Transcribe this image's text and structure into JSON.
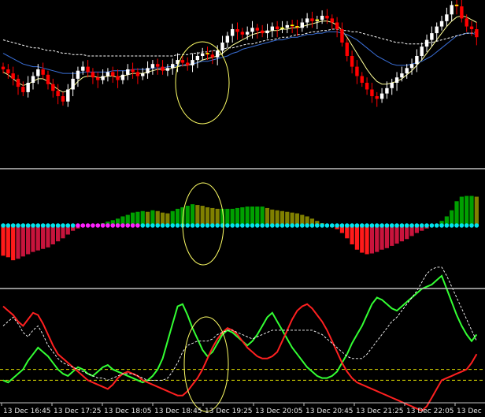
{
  "theme": {
    "background": "#000000",
    "separator": "#c0c0c0",
    "bull_candle": "#ffffff",
    "bear_candle": "#ff0000",
    "doji_mark": "#ffff00",
    "ma_fast": "#ffff99",
    "ma_mid": "#3a6fd8",
    "ma_slow": "#ffffff",
    "histo_up_bright": "#00a000",
    "histo_up_dim": "#808000",
    "histo_down_bright": "#ff1a1a",
    "histo_down_dim": "#c8143c",
    "dot_cyan": "#00e5ee",
    "dot_magenta": "#ff20ff",
    "stoch_green": "#33ff33",
    "stoch_red": "#ff2020",
    "stoch_level": "#e0e000",
    "highlight_ellipse": "#ffff66"
  },
  "chart_data": [
    {
      "type": "candlestick",
      "pane": "price",
      "title": "",
      "bar_count": 96,
      "ylim": [
        0,
        100
      ],
      "candles_close": [
        60,
        57,
        53,
        47,
        43,
        50,
        55,
        60,
        56,
        49,
        44,
        40,
        36,
        45,
        53,
        59,
        62,
        58,
        54,
        52,
        55,
        58,
        55,
        52,
        56,
        60,
        58,
        55,
        57,
        61,
        64,
        62,
        59,
        61,
        64,
        67,
        65,
        63,
        67,
        70,
        72,
        71,
        69,
        74,
        80,
        85,
        90,
        88,
        86,
        88,
        91,
        89,
        87,
        89,
        92,
        90,
        91,
        93,
        92,
        91,
        95,
        98,
        96,
        97,
        100,
        98,
        95,
        90,
        80,
        70,
        62,
        55,
        50,
        45,
        40,
        38,
        42,
        46,
        50,
        54,
        57,
        61,
        64,
        70,
        77,
        82,
        87,
        92,
        96,
        101,
        108,
        107,
        98,
        92,
        90,
        84
      ],
      "moving_averages": [
        {
          "id": "ma_fast",
          "style": "solid",
          "values": [
            58,
            56,
            53,
            50,
            48,
            49,
            51,
            53,
            53,
            51,
            48,
            45,
            43,
            44,
            47,
            51,
            54,
            55,
            55,
            54,
            54,
            55,
            55,
            54,
            55,
            56,
            57,
            57,
            57,
            58,
            59,
            60,
            60,
            60,
            61,
            62,
            63,
            63,
            64,
            65,
            67,
            68,
            69,
            70,
            72,
            75,
            78,
            80,
            82,
            84,
            86,
            87,
            88,
            88,
            89,
            89,
            90,
            90,
            91,
            91,
            92,
            93,
            94,
            95,
            96,
            96,
            95,
            93,
            89,
            84,
            78,
            72,
            66,
            60,
            55,
            51,
            49,
            49,
            50,
            51,
            53,
            56,
            59,
            63,
            67,
            72,
            77,
            82,
            87,
            92,
            96,
            99,
            100,
            99,
            97,
            95
          ]
        },
        {
          "id": "ma_mid",
          "style": "solid",
          "values": [
            72,
            70,
            68,
            66,
            64,
            63,
            62,
            62,
            61,
            60,
            59,
            58,
            57,
            57,
            57,
            57,
            58,
            58,
            58,
            58,
            58,
            58,
            59,
            59,
            59,
            59,
            60,
            60,
            60,
            60,
            61,
            61,
            61,
            62,
            62,
            63,
            63,
            64,
            64,
            65,
            66,
            66,
            67,
            68,
            69,
            70,
            72,
            73,
            75,
            76,
            77,
            78,
            79,
            80,
            81,
            82,
            82,
            83,
            84,
            84,
            85,
            86,
            86,
            87,
            87,
            88,
            88,
            88,
            87,
            86,
            84,
            82,
            79,
            76,
            73,
            70,
            68,
            66,
            64,
            63,
            63,
            63,
            64,
            65,
            66,
            68,
            70,
            73,
            76,
            79,
            82,
            85,
            86,
            87,
            87,
            86
          ]
        },
        {
          "id": "ma_slow",
          "style": "dashed",
          "values": [
            82,
            81,
            80,
            79,
            78,
            77,
            76,
            76,
            75,
            74,
            74,
            73,
            72,
            72,
            71,
            71,
            71,
            70,
            70,
            70,
            70,
            70,
            70,
            70,
            70,
            70,
            70,
            70,
            70,
            70,
            70,
            70,
            70,
            70,
            70,
            71,
            71,
            71,
            72,
            72,
            73,
            73,
            74,
            74,
            75,
            76,
            76,
            77,
            78,
            79,
            79,
            80,
            81,
            82,
            82,
            83,
            84,
            84,
            85,
            86,
            86,
            87,
            88,
            88,
            89,
            89,
            90,
            90,
            89,
            89,
            88,
            88,
            87,
            86,
            85,
            84,
            83,
            82,
            81,
            80,
            80,
            79,
            79,
            79,
            79,
            80,
            80,
            81,
            82,
            83,
            84,
            85,
            86,
            87,
            87,
            88
          ]
        }
      ]
    },
    {
      "type": "bar",
      "pane": "histogram",
      "title": "",
      "ylim": [
        -50,
        50
      ],
      "values": [
        -40,
        -42,
        -46,
        -44,
        -41,
        -38,
        -35,
        -33,
        -31,
        -29,
        -25,
        -21,
        -17,
        -12,
        -7,
        -4,
        -2,
        -1,
        1,
        2,
        3,
        5,
        7,
        9,
        12,
        14,
        17,
        18,
        19,
        18,
        20,
        19,
        17,
        16,
        19,
        22,
        24,
        26,
        28,
        27,
        26,
        24,
        23,
        22,
        22,
        22,
        22,
        23,
        24,
        25,
        25,
        25,
        25,
        23,
        21,
        20,
        19,
        18,
        17,
        16,
        14,
        12,
        9,
        6,
        3,
        0,
        -2,
        -5,
        -10,
        -17,
        -25,
        -32,
        -36,
        -38,
        -37,
        -35,
        -32,
        -30,
        -27,
        -24,
        -21,
        -18,
        -14,
        -10,
        -7,
        -4,
        -1,
        2,
        6,
        12,
        20,
        32,
        38,
        39,
        39,
        38
      ],
      "dot_color_by_bar": "cyan except magenta for bars 15-27"
    },
    {
      "type": "line",
      "pane": "stochastic",
      "title": "",
      "ylim": [
        0,
        100
      ],
      "levels": [
        20,
        30
      ],
      "series": [
        {
          "id": "green",
          "values": [
            20,
            18,
            22,
            26,
            30,
            38,
            44,
            50,
            46,
            42,
            36,
            30,
            26,
            24,
            28,
            32,
            30,
            26,
            24,
            28,
            32,
            34,
            30,
            28,
            26,
            24,
            22,
            20,
            18,
            20,
            24,
            30,
            40,
            56,
            72,
            88,
            90,
            80,
            68,
            58,
            48,
            42,
            46,
            54,
            62,
            66,
            64,
            60,
            56,
            52,
            56,
            62,
            70,
            78,
            82,
            74,
            66,
            58,
            50,
            44,
            38,
            32,
            28,
            24,
            22,
            22,
            24,
            28,
            36,
            44,
            54,
            62,
            70,
            80,
            90,
            96,
            94,
            90,
            86,
            84,
            88,
            92,
            96,
            100,
            104,
            106,
            108,
            112,
            116,
            104,
            92,
            80,
            70,
            62,
            56,
            62
          ]
        },
        {
          "id": "red",
          "values": [
            88,
            84,
            80,
            74,
            70,
            76,
            82,
            80,
            72,
            62,
            52,
            44,
            40,
            36,
            32,
            28,
            24,
            20,
            18,
            16,
            14,
            12,
            16,
            22,
            26,
            28,
            26,
            24,
            20,
            18,
            16,
            14,
            12,
            10,
            8,
            6,
            6,
            10,
            16,
            22,
            30,
            40,
            50,
            58,
            64,
            68,
            66,
            62,
            56,
            50,
            46,
            42,
            40,
            40,
            42,
            46,
            56,
            66,
            76,
            84,
            88,
            90,
            86,
            80,
            74,
            66,
            56,
            46,
            36,
            28,
            22,
            18,
            16,
            14,
            12,
            10,
            8,
            6,
            4,
            2,
            0,
            -2,
            -4,
            -6,
            -8,
            -4,
            4,
            12,
            20,
            22,
            24,
            26,
            28,
            30,
            36,
            44
          ]
        },
        {
          "id": "signal",
          "style": "dashed",
          "values": [
            70,
            74,
            78,
            72,
            64,
            60,
            66,
            70,
            62,
            52,
            46,
            40,
            36,
            34,
            32,
            30,
            28,
            26,
            24,
            22,
            22,
            20,
            22,
            24,
            26,
            26,
            26,
            24,
            22,
            20,
            20,
            20,
            20,
            22,
            28,
            36,
            46,
            52,
            54,
            56,
            56,
            56,
            58,
            62,
            64,
            66,
            66,
            64,
            62,
            60,
            58,
            60,
            62,
            64,
            66,
            66,
            66,
            66,
            66,
            66,
            66,
            66,
            66,
            64,
            62,
            58,
            54,
            50,
            46,
            42,
            40,
            40,
            40,
            44,
            50,
            56,
            62,
            68,
            74,
            78,
            84,
            90,
            96,
            102,
            110,
            118,
            122,
            124,
            124,
            116,
            106,
            96,
            86,
            76,
            66,
            56
          ]
        }
      ],
      "x_tick_labels": [
        "13 Dec 16:45",
        "13 Dec 17:25",
        "13 Dec 18:05",
        "13 Dec 18:45",
        "13 Dec 19:25",
        "13 Dec 20:05",
        "13 Dec 20:45",
        "13 Dec 21:25",
        "13 Dec 22:05",
        "13 Dec"
      ]
    }
  ]
}
